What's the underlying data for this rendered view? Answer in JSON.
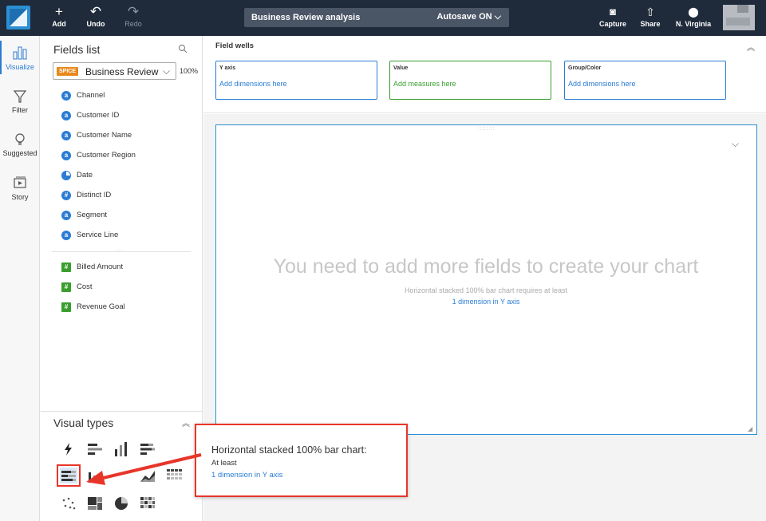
{
  "topbar": {
    "add_label": "Add",
    "undo_label": "Undo",
    "redo_label": "Redo",
    "analysis_name": "Business Review analysis",
    "autosave_label": "Autosave ON",
    "capture_label": "Capture",
    "share_label": "Share",
    "region_label": "N. Virginia"
  },
  "rail": {
    "items": [
      {
        "label": "Visualize",
        "icon": "bar-chart-icon"
      },
      {
        "label": "Filter",
        "icon": "filter-icon"
      },
      {
        "label": "Suggested",
        "icon": "lightbulb-icon"
      },
      {
        "label": "Story",
        "icon": "story-icon"
      }
    ]
  },
  "fields_panel": {
    "title": "Fields list",
    "dataset_badge": "SPICE",
    "dataset_name": "Business Review",
    "dataset_percent": "100%",
    "dimensions": [
      {
        "name": "Channel",
        "type": "string"
      },
      {
        "name": "Customer ID",
        "type": "string"
      },
      {
        "name": "Customer Name",
        "type": "string"
      },
      {
        "name": "Customer Region",
        "type": "string"
      },
      {
        "name": "Date",
        "type": "date"
      },
      {
        "name": "Distinct ID",
        "type": "number"
      },
      {
        "name": "Segment",
        "type": "string"
      },
      {
        "name": "Service Line",
        "type": "string"
      }
    ],
    "measures": [
      {
        "name": "Billed Amount",
        "type": "measure"
      },
      {
        "name": "Cost",
        "type": "measure"
      },
      {
        "name": "Revenue Goal",
        "type": "measure"
      }
    ]
  },
  "visual_types": {
    "title": "Visual types",
    "selected": "horizontal-stacked-100-bar-chart"
  },
  "field_wells": {
    "title": "Field wells",
    "wells": [
      {
        "title": "Y axis",
        "hint": "Add dimensions here",
        "color": "#2b7cd3"
      },
      {
        "title": "Value",
        "hint": "Add measures here",
        "color": "#3a9e2e"
      },
      {
        "title": "Group/Color",
        "hint": "Add dimensions here",
        "color": "#2b7cd3"
      }
    ]
  },
  "visual": {
    "message": "You need to add more fields to create your chart",
    "requirement": "Horizontal stacked 100% bar chart requires at least",
    "requirement_link": "1 dimension in Y axis"
  },
  "tooltip": {
    "title": "Horizontal stacked 100% bar chart:",
    "subtitle": "At least",
    "link": "1 dimension in Y axis"
  },
  "colors": {
    "topbar": "#1f2b3a",
    "accent": "#2b7cd3",
    "measure": "#3a9e2e",
    "highlight": "#e8352a",
    "spice": "#e8891d"
  }
}
